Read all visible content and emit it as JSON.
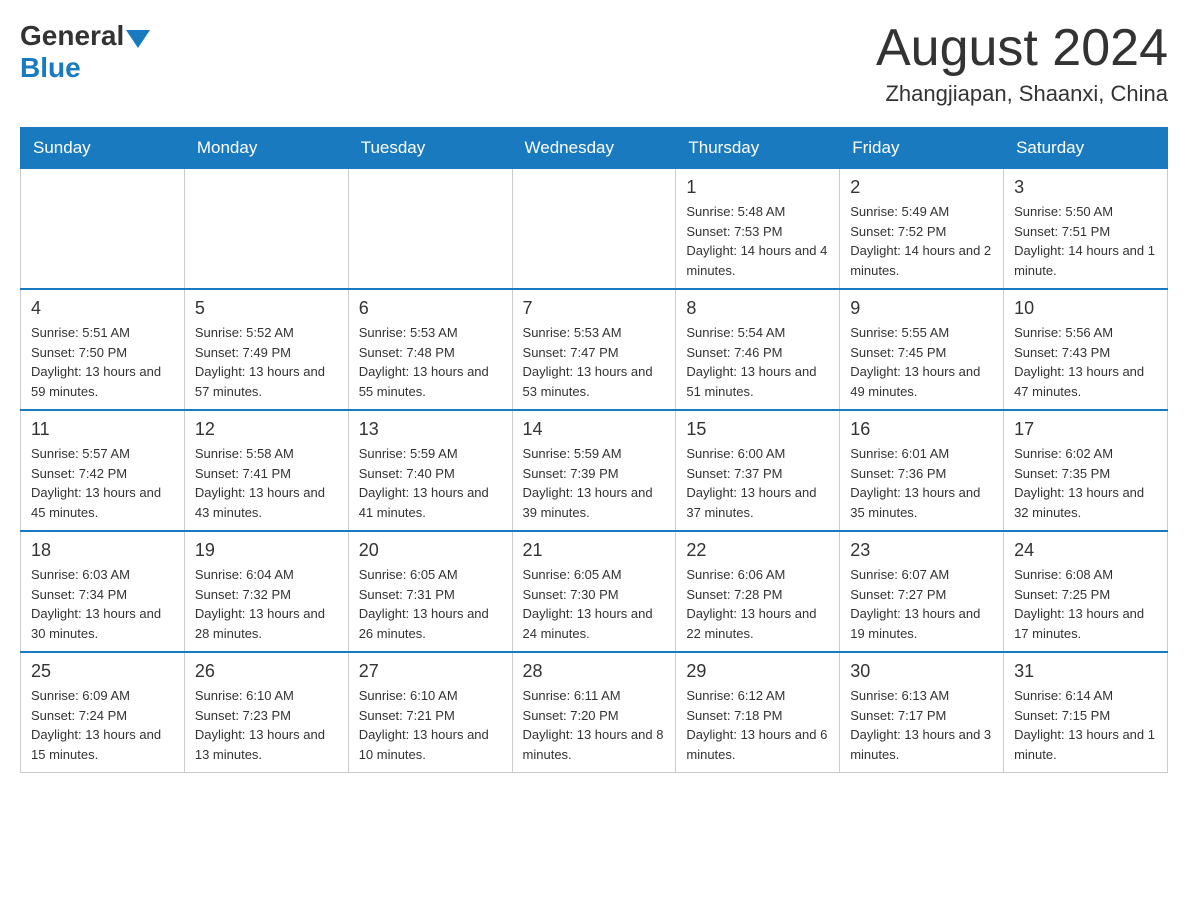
{
  "logo": {
    "general": "General",
    "blue": "Blue"
  },
  "title": {
    "month_year": "August 2024",
    "location": "Zhangjiapan, Shaanxi, China"
  },
  "days_of_week": [
    "Sunday",
    "Monday",
    "Tuesday",
    "Wednesday",
    "Thursday",
    "Friday",
    "Saturday"
  ],
  "weeks": [
    {
      "days": [
        {
          "number": "",
          "info": ""
        },
        {
          "number": "",
          "info": ""
        },
        {
          "number": "",
          "info": ""
        },
        {
          "number": "",
          "info": ""
        },
        {
          "number": "1",
          "info": "Sunrise: 5:48 AM\nSunset: 7:53 PM\nDaylight: 14 hours and 4 minutes."
        },
        {
          "number": "2",
          "info": "Sunrise: 5:49 AM\nSunset: 7:52 PM\nDaylight: 14 hours and 2 minutes."
        },
        {
          "number": "3",
          "info": "Sunrise: 5:50 AM\nSunset: 7:51 PM\nDaylight: 14 hours and 1 minute."
        }
      ]
    },
    {
      "days": [
        {
          "number": "4",
          "info": "Sunrise: 5:51 AM\nSunset: 7:50 PM\nDaylight: 13 hours and 59 minutes."
        },
        {
          "number": "5",
          "info": "Sunrise: 5:52 AM\nSunset: 7:49 PM\nDaylight: 13 hours and 57 minutes."
        },
        {
          "number": "6",
          "info": "Sunrise: 5:53 AM\nSunset: 7:48 PM\nDaylight: 13 hours and 55 minutes."
        },
        {
          "number": "7",
          "info": "Sunrise: 5:53 AM\nSunset: 7:47 PM\nDaylight: 13 hours and 53 minutes."
        },
        {
          "number": "8",
          "info": "Sunrise: 5:54 AM\nSunset: 7:46 PM\nDaylight: 13 hours and 51 minutes."
        },
        {
          "number": "9",
          "info": "Sunrise: 5:55 AM\nSunset: 7:45 PM\nDaylight: 13 hours and 49 minutes."
        },
        {
          "number": "10",
          "info": "Sunrise: 5:56 AM\nSunset: 7:43 PM\nDaylight: 13 hours and 47 minutes."
        }
      ]
    },
    {
      "days": [
        {
          "number": "11",
          "info": "Sunrise: 5:57 AM\nSunset: 7:42 PM\nDaylight: 13 hours and 45 minutes."
        },
        {
          "number": "12",
          "info": "Sunrise: 5:58 AM\nSunset: 7:41 PM\nDaylight: 13 hours and 43 minutes."
        },
        {
          "number": "13",
          "info": "Sunrise: 5:59 AM\nSunset: 7:40 PM\nDaylight: 13 hours and 41 minutes."
        },
        {
          "number": "14",
          "info": "Sunrise: 5:59 AM\nSunset: 7:39 PM\nDaylight: 13 hours and 39 minutes."
        },
        {
          "number": "15",
          "info": "Sunrise: 6:00 AM\nSunset: 7:37 PM\nDaylight: 13 hours and 37 minutes."
        },
        {
          "number": "16",
          "info": "Sunrise: 6:01 AM\nSunset: 7:36 PM\nDaylight: 13 hours and 35 minutes."
        },
        {
          "number": "17",
          "info": "Sunrise: 6:02 AM\nSunset: 7:35 PM\nDaylight: 13 hours and 32 minutes."
        }
      ]
    },
    {
      "days": [
        {
          "number": "18",
          "info": "Sunrise: 6:03 AM\nSunset: 7:34 PM\nDaylight: 13 hours and 30 minutes."
        },
        {
          "number": "19",
          "info": "Sunrise: 6:04 AM\nSunset: 7:32 PM\nDaylight: 13 hours and 28 minutes."
        },
        {
          "number": "20",
          "info": "Sunrise: 6:05 AM\nSunset: 7:31 PM\nDaylight: 13 hours and 26 minutes."
        },
        {
          "number": "21",
          "info": "Sunrise: 6:05 AM\nSunset: 7:30 PM\nDaylight: 13 hours and 24 minutes."
        },
        {
          "number": "22",
          "info": "Sunrise: 6:06 AM\nSunset: 7:28 PM\nDaylight: 13 hours and 22 minutes."
        },
        {
          "number": "23",
          "info": "Sunrise: 6:07 AM\nSunset: 7:27 PM\nDaylight: 13 hours and 19 minutes."
        },
        {
          "number": "24",
          "info": "Sunrise: 6:08 AM\nSunset: 7:25 PM\nDaylight: 13 hours and 17 minutes."
        }
      ]
    },
    {
      "days": [
        {
          "number": "25",
          "info": "Sunrise: 6:09 AM\nSunset: 7:24 PM\nDaylight: 13 hours and 15 minutes."
        },
        {
          "number": "26",
          "info": "Sunrise: 6:10 AM\nSunset: 7:23 PM\nDaylight: 13 hours and 13 minutes."
        },
        {
          "number": "27",
          "info": "Sunrise: 6:10 AM\nSunset: 7:21 PM\nDaylight: 13 hours and 10 minutes."
        },
        {
          "number": "28",
          "info": "Sunrise: 6:11 AM\nSunset: 7:20 PM\nDaylight: 13 hours and 8 minutes."
        },
        {
          "number": "29",
          "info": "Sunrise: 6:12 AM\nSunset: 7:18 PM\nDaylight: 13 hours and 6 minutes."
        },
        {
          "number": "30",
          "info": "Sunrise: 6:13 AM\nSunset: 7:17 PM\nDaylight: 13 hours and 3 minutes."
        },
        {
          "number": "31",
          "info": "Sunrise: 6:14 AM\nSunset: 7:15 PM\nDaylight: 13 hours and 1 minute."
        }
      ]
    }
  ]
}
